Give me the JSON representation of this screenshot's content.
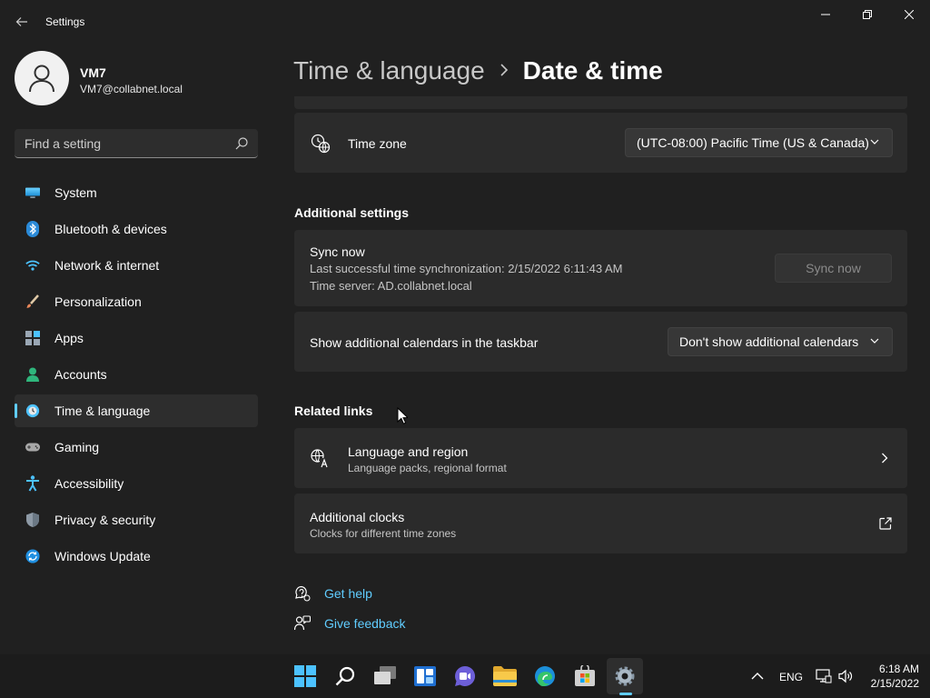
{
  "app": {
    "title": "Settings"
  },
  "profile": {
    "name": "VM7",
    "email": "VM7@collabnet.local"
  },
  "search": {
    "placeholder": "Find a setting"
  },
  "sidebar": {
    "items": [
      {
        "label": "System",
        "icon": "monitor-icon"
      },
      {
        "label": "Bluetooth & devices",
        "icon": "bluetooth-icon"
      },
      {
        "label": "Network & internet",
        "icon": "wifi-icon"
      },
      {
        "label": "Personalization",
        "icon": "paintbrush-icon"
      },
      {
        "label": "Apps",
        "icon": "apps-icon"
      },
      {
        "label": "Accounts",
        "icon": "person-icon"
      },
      {
        "label": "Time & language",
        "icon": "globe-clock-icon",
        "active": true
      },
      {
        "label": "Gaming",
        "icon": "gamepad-icon"
      },
      {
        "label": "Accessibility",
        "icon": "accessibility-icon"
      },
      {
        "label": "Privacy & security",
        "icon": "shield-icon"
      },
      {
        "label": "Windows Update",
        "icon": "update-icon"
      }
    ]
  },
  "header": {
    "parent": "Time & language",
    "current": "Date & time"
  },
  "timezone": {
    "label": "Time zone",
    "value": "(UTC-08:00) Pacific Time (US & Canada)"
  },
  "additional_settings": {
    "heading": "Additional settings",
    "sync": {
      "title": "Sync now",
      "last_sync": "Last successful time synchronization: 2/15/2022 6:11:43 AM",
      "server": "Time server: AD.collabnet.local",
      "button": "Sync now"
    },
    "calendars": {
      "label": "Show additional calendars in the taskbar",
      "value": "Don't show additional calendars"
    }
  },
  "related_links": {
    "heading": "Related links",
    "language_region": {
      "title": "Language and region",
      "subtitle": "Language packs, regional format"
    },
    "additional_clocks": {
      "title": "Additional clocks",
      "subtitle": "Clocks for different time zones"
    }
  },
  "help": {
    "get_help": "Get help",
    "give_feedback": "Give feedback"
  },
  "taskbar": {
    "apps": [
      "start-icon",
      "search-icon",
      "task-view-icon",
      "widgets-icon",
      "chat-icon",
      "file-explorer-icon",
      "edge-icon",
      "store-icon",
      "settings-icon"
    ],
    "language": "ENG",
    "time": "6:18 AM",
    "date": "2/15/2022"
  },
  "colors": {
    "accent": "#60cdff",
    "background": "#202020",
    "card": "#2b2b2b"
  }
}
